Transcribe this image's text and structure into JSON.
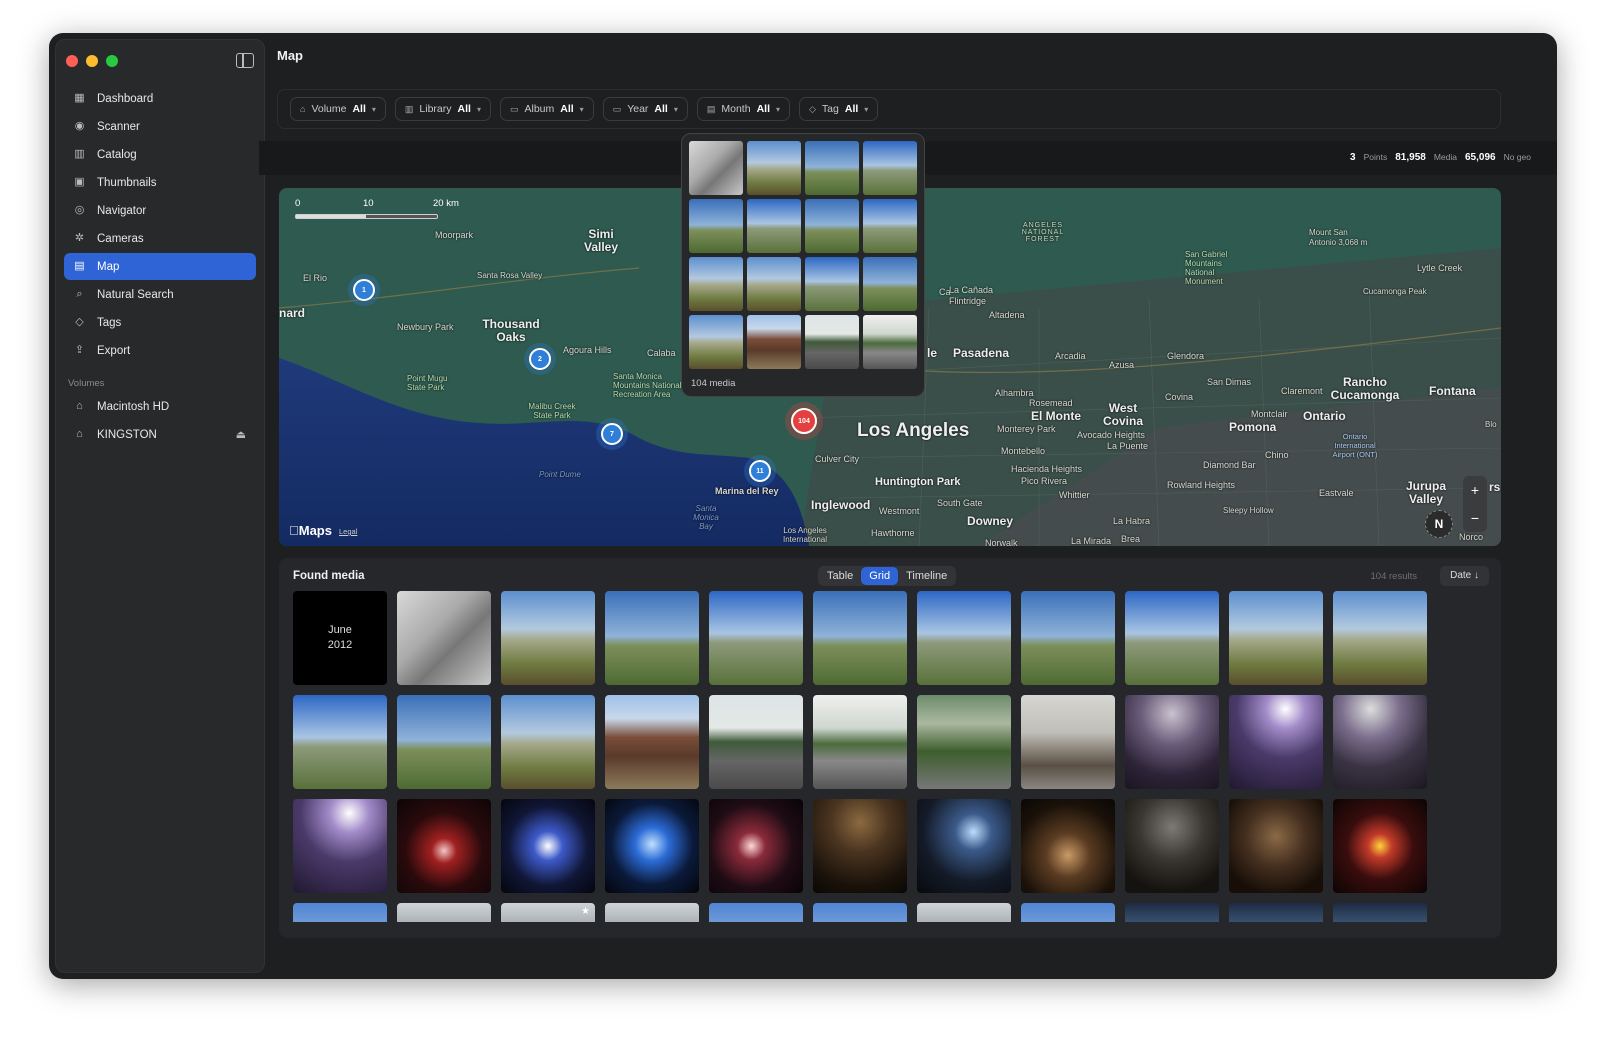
{
  "window": {
    "title": "Map"
  },
  "colors": {
    "accent": "#2f64d6",
    "pin_blue": "#2f7fd9",
    "pin_red": "#e5403f",
    "close": "#ff5f57",
    "minimize": "#febc2e",
    "zoom": "#28c840"
  },
  "sidebar": {
    "items": [
      {
        "label": "Dashboard",
        "icon": "grid-icon"
      },
      {
        "label": "Scanner",
        "icon": "broadcast-icon"
      },
      {
        "label": "Catalog",
        "icon": "books-icon"
      },
      {
        "label": "Thumbnails",
        "icon": "photos-icon"
      },
      {
        "label": "Navigator",
        "icon": "compass-icon"
      },
      {
        "label": "Cameras",
        "icon": "aperture-icon"
      },
      {
        "label": "Map",
        "icon": "map-icon",
        "active": true
      },
      {
        "label": "Natural Search",
        "icon": "magnifier-icon"
      },
      {
        "label": "Tags",
        "icon": "tag-icon"
      },
      {
        "label": "Export",
        "icon": "share-icon"
      }
    ],
    "volumes_label": "Volumes",
    "volumes": [
      {
        "label": "Macintosh HD",
        "icon": "drive-icon"
      },
      {
        "label": "KINGSTON",
        "icon": "drive-icon",
        "ejectable": true
      }
    ]
  },
  "filters": [
    {
      "label": "Volume",
      "value": "All",
      "icon": "drive-icon"
    },
    {
      "label": "Library",
      "value": "All",
      "icon": "books-icon"
    },
    {
      "label": "Album",
      "value": "All",
      "icon": "album-icon"
    },
    {
      "label": "Year",
      "value": "All",
      "icon": "calendar-icon"
    },
    {
      "label": "Month",
      "value": "All",
      "icon": "calendar-icon"
    },
    {
      "label": "Tag",
      "value": "All",
      "icon": "tag-icon"
    }
  ],
  "stats": {
    "points": "3",
    "points_label": "Points",
    "media": "81,958",
    "media_label": "Media",
    "nogeo": "65,096",
    "nogeo_label": "No geo"
  },
  "map": {
    "scale": {
      "zero": "0",
      "mid": "10",
      "max": "20 km"
    },
    "brand": "Maps",
    "legal": "Legal",
    "compass": "N",
    "zoom_in": "+",
    "zoom_out": "−",
    "clusters": [
      {
        "count": "1",
        "color": "blue"
      },
      {
        "count": "2",
        "color": "blue"
      },
      {
        "count": "7",
        "color": "blue"
      },
      {
        "count": "11",
        "color": "blue"
      },
      {
        "count": "104",
        "color": "red"
      }
    ],
    "places": [
      "Moorpark",
      "Simi Valley",
      "El Rio",
      "Santa Rosa Valley",
      "Newbury Park",
      "Thousand Oaks",
      "Agoura Hills",
      "Calaba",
      "Point Mugu State Park",
      "Santa Monica Mountains National Recreation Area",
      "Malibu Creek State Park",
      "Point Dume",
      "Marina del Rey",
      "Santa Monica Bay",
      "Culver City",
      "Inglewood",
      "Los Angeles",
      "Los Angeles International",
      "Huntington Park",
      "Westmont",
      "Hawthorne",
      "South Gate",
      "Downey",
      "Norwalk",
      "La Mirada",
      "Brea",
      "Pasadena",
      "Arcadia",
      "Azusa",
      "Glendora",
      "La Cañada Flintridge",
      "Altadena",
      "Alhambra",
      "Rosemead",
      "El Monte",
      "Monterey Park",
      "Montebello",
      "Hacienda Heights",
      "Pico Rivera",
      "Whittier",
      "La Habra",
      "West Covina",
      "Avocado Heights",
      "La Puente",
      "Covina",
      "San Dimas",
      "Claremont",
      "Montclair",
      "Ontario",
      "Ontario International Airport (ONT)",
      "Pomona",
      "Chino",
      "Diamond Bar",
      "Rowland Heights",
      "Sleepy Hollow",
      "Rancho Cucamonga",
      "Fontana",
      "Eastvale",
      "Jurupa Valley",
      "Norco",
      "ANGELES NATIONAL FOREST",
      "San Gabriel Mountains National Monument",
      "Mount San Antonio 3,068 m",
      "Lytle Creek",
      "Cucamonga Peak",
      "Blo",
      "rs",
      "nard",
      "le",
      "Ca"
    ]
  },
  "popover": {
    "count_label": "104 media"
  },
  "found": {
    "title": "Found media",
    "views": [
      "Table",
      "Grid",
      "Timeline"
    ],
    "active_view": "Grid",
    "results": "104 results",
    "sort": "Date ↓",
    "month_tile": {
      "month": "June",
      "year": "2012"
    }
  }
}
